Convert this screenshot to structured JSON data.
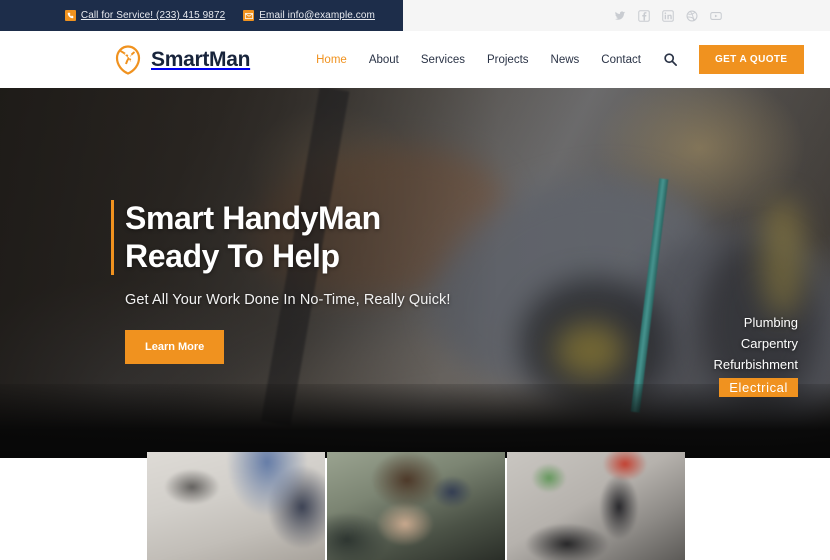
{
  "topbar": {
    "phone": {
      "icon": "phone-icon",
      "label": "Call for Service! (233) 415 9872"
    },
    "email": {
      "icon": "envelope-icon",
      "label": "Email info@example.com"
    },
    "social": [
      {
        "name": "twitter-icon",
        "label": "Twitter"
      },
      {
        "name": "facebook-icon",
        "label": "Facebook"
      },
      {
        "name": "linkedin-icon",
        "label": "LinkedIn"
      },
      {
        "name": "dribbble-icon",
        "label": "Dribbble"
      },
      {
        "name": "youtube-icon",
        "label": "YouTube"
      }
    ]
  },
  "header": {
    "brand": "SmartMan",
    "logo_icon": "swirl-wrench-logo",
    "nav": [
      {
        "label": "Home",
        "active": true
      },
      {
        "label": "About",
        "active": false
      },
      {
        "label": "Services",
        "active": false
      },
      {
        "label": "Projects",
        "active": false
      },
      {
        "label": "News",
        "active": false
      },
      {
        "label": "Contact",
        "active": false
      }
    ],
    "search_icon": "search-icon",
    "quote_button": "GET A QUOTE"
  },
  "hero": {
    "title_line1": "Smart HandyMan",
    "title_line2": "Ready To Help",
    "subtitle": "Get All Your Work Done In No-Time, Really Quick!",
    "cta": "Learn More",
    "services": [
      {
        "label": "Plumbing",
        "active": false
      },
      {
        "label": "Carpentry",
        "active": false
      },
      {
        "label": "Refurbishment",
        "active": false
      },
      {
        "label": "Electrical",
        "active": true
      }
    ]
  },
  "thumbnails": [
    {
      "name": "thumb-flooring-install"
    },
    {
      "name": "thumb-worker-safety-gear"
    },
    {
      "name": "thumb-power-drill"
    }
  ],
  "colors": {
    "accent": "#f0921f",
    "dark_navy": "#1d2d4a",
    "text_dark": "#18243c",
    "topbar_light": "#f5f5f5"
  }
}
